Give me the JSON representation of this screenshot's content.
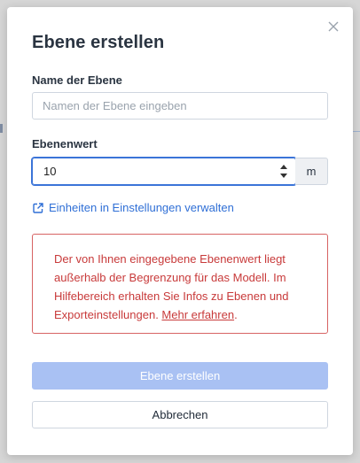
{
  "dialog": {
    "title": "Ebene erstellen",
    "close_icon": "close-icon"
  },
  "name_field": {
    "label": "Name der Ebene",
    "placeholder": "Namen der Ebene eingeben",
    "value": ""
  },
  "value_field": {
    "label": "Ebenenwert",
    "value": "10",
    "unit": "m"
  },
  "settings_link": {
    "icon": "external-link-icon",
    "label": "Einheiten in Einstellungen verwalten"
  },
  "alert": {
    "text": "Der von Ihnen eingegebene Ebenenwert liegt außerhalb der Begrenzung für das Modell. Im Hilfebereich erhalten Sie Infos zu Ebenen und Exporteinstellungen. ",
    "link_label": "Mehr erfahren",
    "suffix": ".",
    "color": "#c83a3a"
  },
  "buttons": {
    "create_label": "Ebene erstellen",
    "cancel_label": "Abbrechen",
    "create_color": "#a9c1f3"
  },
  "colors": {
    "accent": "#2f6fd6",
    "error": "#c83a3a"
  }
}
